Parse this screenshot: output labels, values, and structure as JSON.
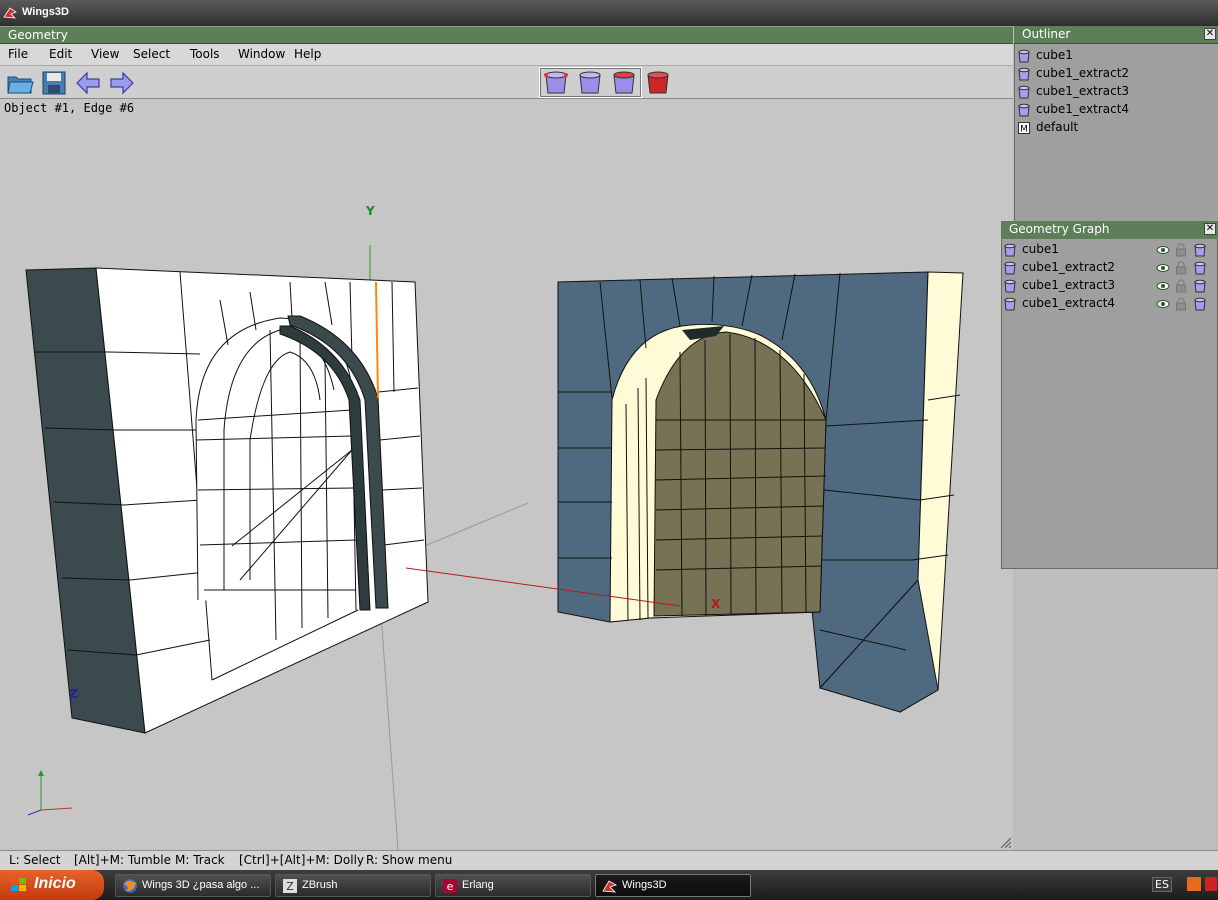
{
  "window": {
    "title": "Wings3D"
  },
  "geometry": {
    "title": "Geometry",
    "menu": [
      "File",
      "Edit",
      "View",
      "Select",
      "Tools",
      "Window",
      "Help"
    ],
    "info": "Object #1, Edge #6",
    "axes": {
      "y": "Y",
      "x": "X",
      "z": "Z"
    }
  },
  "outliner": {
    "title": "Outliner",
    "items": [
      "cube1",
      "cube1_extract2",
      "cube1_extract3",
      "cube1_extract4",
      "default"
    ]
  },
  "geometry_graph": {
    "title": "Geometry Graph",
    "items": [
      "cube1",
      "cube1_extract2",
      "cube1_extract3",
      "cube1_extract4"
    ]
  },
  "statusbar": {
    "select": "L: Select",
    "tumble": "[Alt]+M: Tumble",
    "track": "M: Track",
    "dolly": "[Ctrl]+[Alt]+M: Dolly",
    "menu": "R: Show menu"
  },
  "taskbar": {
    "start": "Inicio",
    "tasks": [
      "Wings 3D ¿pasa algo ...",
      "ZBrush",
      "Erlang",
      "Wings3D"
    ],
    "lang": "ES"
  },
  "colors": {
    "panel_title": "#5d7f58",
    "face_selected": "#4f6a80",
    "face_white": "#ffffff",
    "face_cream": "#fffbd6",
    "face_olive": "#767253",
    "face_dark": "#3b4a4c",
    "edge_selected": "#ff8800"
  }
}
